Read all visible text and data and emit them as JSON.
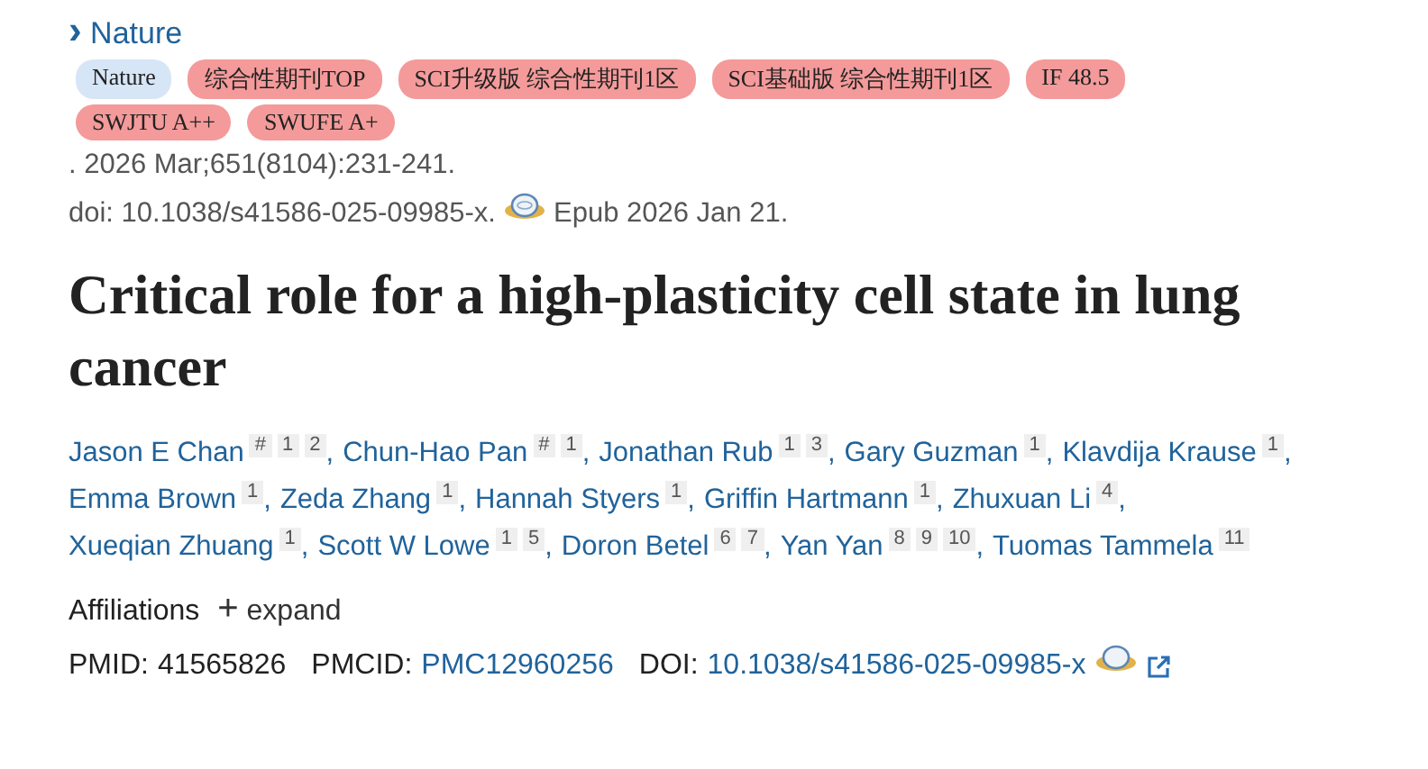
{
  "journal_link": {
    "icon": "›",
    "label": "Nature"
  },
  "tags": [
    {
      "label": "Nature",
      "color": "#d6e6f7"
    },
    {
      "label": "综合性期刊TOP",
      "color": "#f49a9a"
    },
    {
      "label": "SCI升级版 综合性期刊1区",
      "color": "#f49a9a"
    },
    {
      "label": "SCI基础版 综合性期刊1区",
      "color": "#f49a9a"
    },
    {
      "label": "IF 48.5",
      "color": "#f49a9a"
    },
    {
      "label": "SWJTU A++",
      "color": "#f49a9a"
    },
    {
      "label": "SWUFE A+",
      "color": "#f49a9a"
    }
  ],
  "citation": ". 2026 Mar;651(8104):231-241.",
  "doi_line": {
    "doi": "doi: 10.1038/s41586-025-09985-x.",
    "epub": "Epub 2026 Jan 21."
  },
  "title": "Critical role for a high-plasticity cell state in lung cancer",
  "author_lines": [
    [
      {
        "name": "Jason E Chan",
        "marks": [
          "#",
          "1",
          "2"
        ],
        "separator": ","
      },
      {
        "name": "Chun-Hao Pan",
        "marks": [
          "#",
          "1"
        ],
        "separator": ","
      },
      {
        "name": "Jonathan Rub",
        "marks": [
          "1",
          "3"
        ],
        "separator": ","
      },
      {
        "name": "Gary Guzman",
        "marks": [
          "1"
        ],
        "separator": ","
      },
      {
        "name": "Klavdija Krause",
        "marks": [
          "1"
        ],
        "separator": ","
      }
    ],
    [
      {
        "name": "Emma Brown",
        "marks": [
          "1"
        ],
        "separator": ","
      },
      {
        "name": "Zeda Zhang",
        "marks": [
          "1"
        ],
        "separator": ","
      },
      {
        "name": "Hannah Styers",
        "marks": [
          "1"
        ],
        "separator": ","
      },
      {
        "name": "Griffin Hartmann",
        "marks": [
          "1"
        ],
        "separator": ","
      },
      {
        "name": "Zhuxuan Li",
        "marks": [
          "4"
        ],
        "separator": ","
      }
    ],
    [
      {
        "name": "Xueqian Zhuang",
        "marks": [
          "1"
        ],
        "separator": ","
      },
      {
        "name": "Scott W Lowe",
        "marks": [
          "1",
          "5"
        ],
        "separator": ","
      },
      {
        "name": "Doron Betel",
        "marks": [
          "6",
          "7"
        ],
        "separator": ","
      },
      {
        "name": "Yan Yan",
        "marks": [
          "8",
          "9",
          "10"
        ],
        "separator": ","
      },
      {
        "name": "Tuomas Tammela",
        "marks": [
          "11"
        ]
      }
    ]
  ],
  "affiliations": {
    "label": "Affiliations",
    "toggle_icon": "+",
    "toggle": "expand"
  },
  "identifiers": {
    "pmid_label": "PMID:",
    "pmid": "41565826",
    "pmcid_label": "PMCID:",
    "pmcid": "PMC12960256",
    "doi_label": "DOI:",
    "doi": "10.1038/s41586-025-09985-x"
  }
}
